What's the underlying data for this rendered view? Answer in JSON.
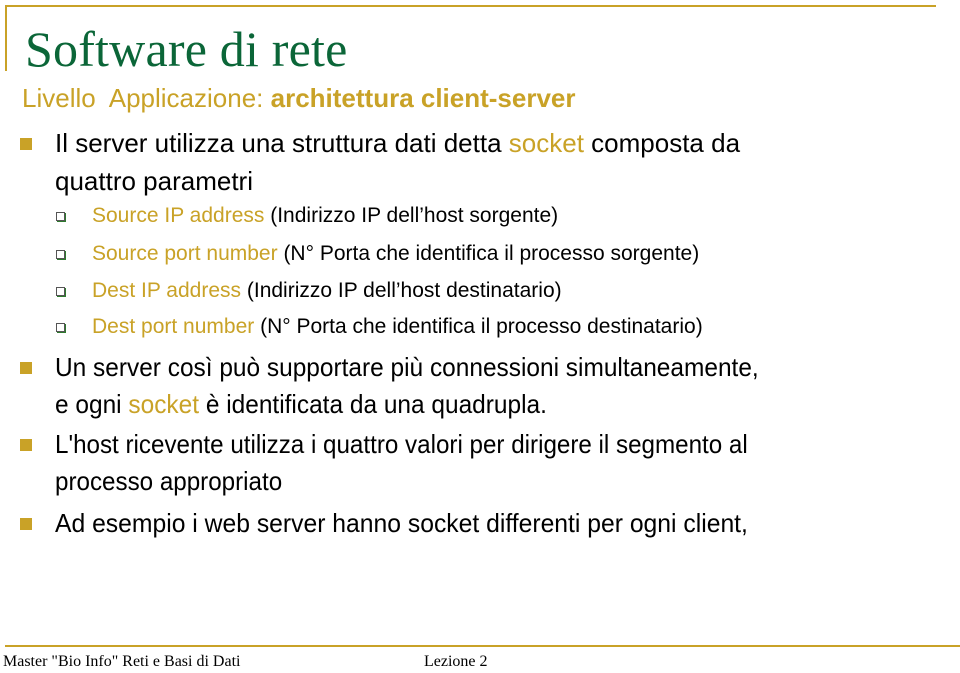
{
  "slide": {
    "title": "Software di rete",
    "subtitle": {
      "prefix": "Livello  Applicazione: ",
      "bold": "architettura client-server"
    },
    "bullets": [
      {
        "line1": {
          "before": "Il server utilizza una struttura dati detta ",
          "highlight": "socket",
          "after": " composta da"
        },
        "line2": "quattro parametri"
      },
      {
        "line1": "Un server così può supportare più connessioni simultaneamente,",
        "line2": {
          "before": "e ogni ",
          "highlight": "socket",
          "after": " è identificata da una quadrupla."
        }
      },
      {
        "line1": "L'host ricevente utilizza i quattro valori per dirigere il segmento al",
        "line2": "processo appropriato"
      },
      {
        "line1": "Ad esempio i web server hanno socket differenti per ogni client,"
      }
    ],
    "sub_bullets": [
      {
        "term": "Source IP address",
        "desc": " (Indirizzo IP dell’host sorgente)"
      },
      {
        "term": "Source port number",
        "desc": " (N° Porta che identifica il processo sorgente)"
      },
      {
        "term": "Dest IP address",
        "desc": " (Indirizzo IP dell’host destinatario)"
      },
      {
        "term": "Dest port number",
        "desc": " (N° Porta che identifica il processo destinatario)"
      }
    ]
  },
  "footer": {
    "left": "Master \"Bio Info\" Reti e Basi di Dati",
    "center": "Lezione 2"
  },
  "colors": {
    "accent_gold": "#c9a227",
    "title_green": "#0b6638",
    "text": "#000000"
  }
}
